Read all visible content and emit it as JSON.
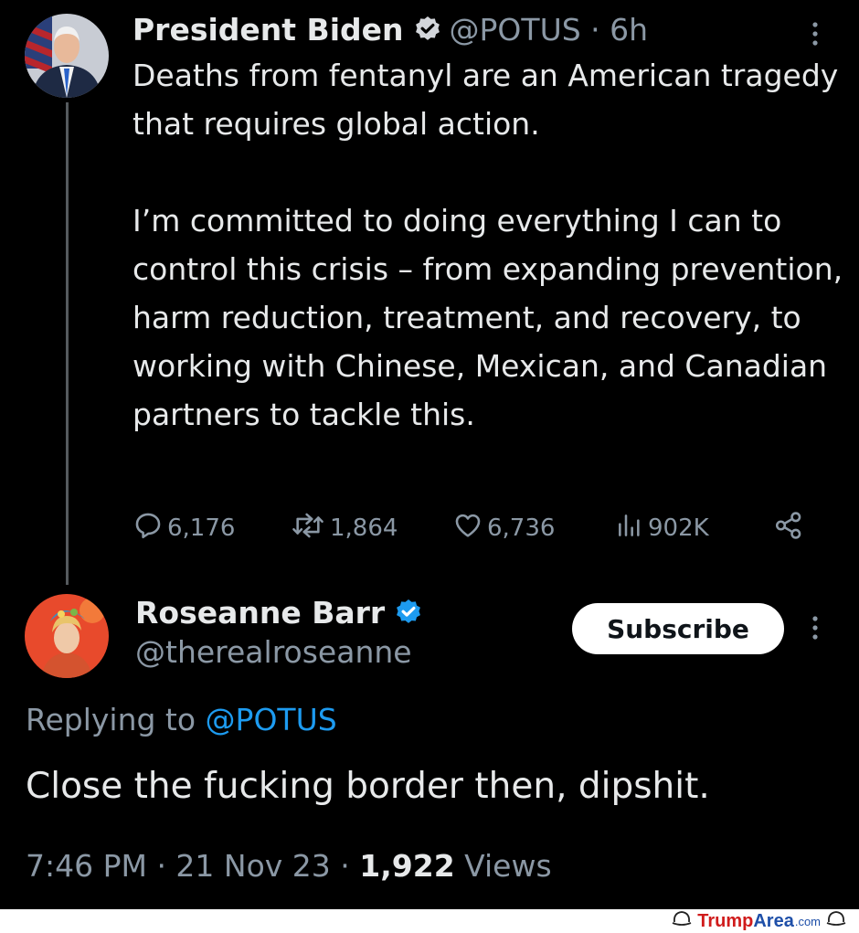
{
  "tweet1": {
    "name": "President Biden",
    "handle": "@POTUS · 6h",
    "paragraph1": "Deaths from fentanyl are an American tragedy that requires global action.",
    "paragraph2": "I’m committed to doing everything I can to control this crisis – from expanding prevention, harm reduction, treatment, and recovery, to working with Chinese, Mexican, and Canadian partners to tackle this.",
    "replies": "6,176",
    "reposts": "1,864",
    "likes": "6,736",
    "views": "902K"
  },
  "tweet2": {
    "name": "Roseanne Barr",
    "handle": "@therealroseanne",
    "subscribe_label": "Subscribe",
    "replying_prefix": "Replying to",
    "replying_mention": "@POTUS",
    "text": "Close the fucking border then, dipshit.",
    "time": "7:46 PM · 21 Nov 23 · ",
    "views_count": "1,922",
    "views_label": " Views"
  },
  "watermark": {
    "trump": "Trump",
    "area": "Area",
    "com": ".com"
  },
  "colors": {
    "background": "#000000",
    "text": "#e7e9ea",
    "muted": "#8b98a5",
    "accent": "#1d9bf0",
    "thread_line": "#555a5e"
  },
  "icons": [
    "verified-badge-icon",
    "more-vertical-icon",
    "reply-icon",
    "repost-icon",
    "like-icon",
    "views-icon",
    "share-icon"
  ]
}
